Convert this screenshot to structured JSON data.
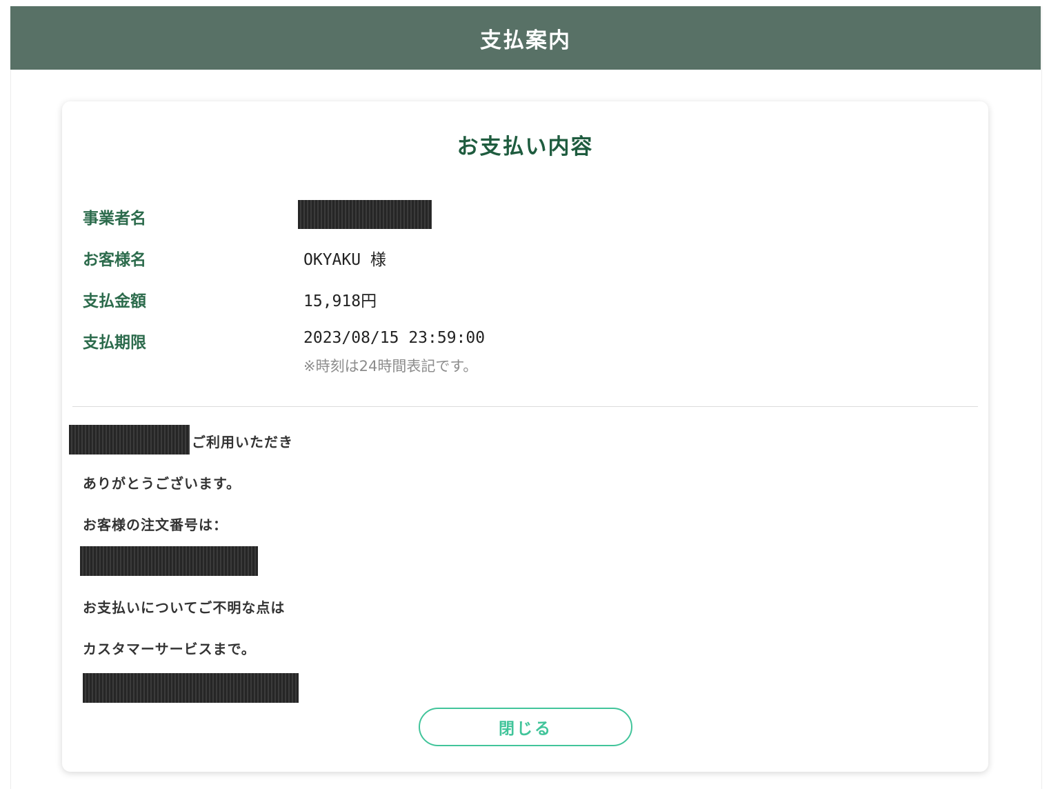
{
  "header": {
    "title": "支払案内"
  },
  "card": {
    "title": "お支払い内容",
    "rows": [
      {
        "label": "事業者名",
        "value": ""
      },
      {
        "label": "お客様名",
        "value": "OKYAKU 様"
      },
      {
        "label": "支払金額",
        "value": "15,918円"
      },
      {
        "label": "支払期限",
        "value": "2023/08/15 23:59:00",
        "note": "※時刻は24時間表記です。"
      }
    ],
    "messages": {
      "line1_suffix": "ご利用いただき",
      "line2": "ありがとうございます。",
      "line3": "お客様の注文番号は：",
      "line4": "お支払いについてご不明な点は",
      "line5": "カスタマーサービスまで。"
    },
    "close_label": "閉じる"
  },
  "colors": {
    "header_bg": "#587166",
    "accent": "#41c49a",
    "label_green": "#2c6b4c"
  }
}
